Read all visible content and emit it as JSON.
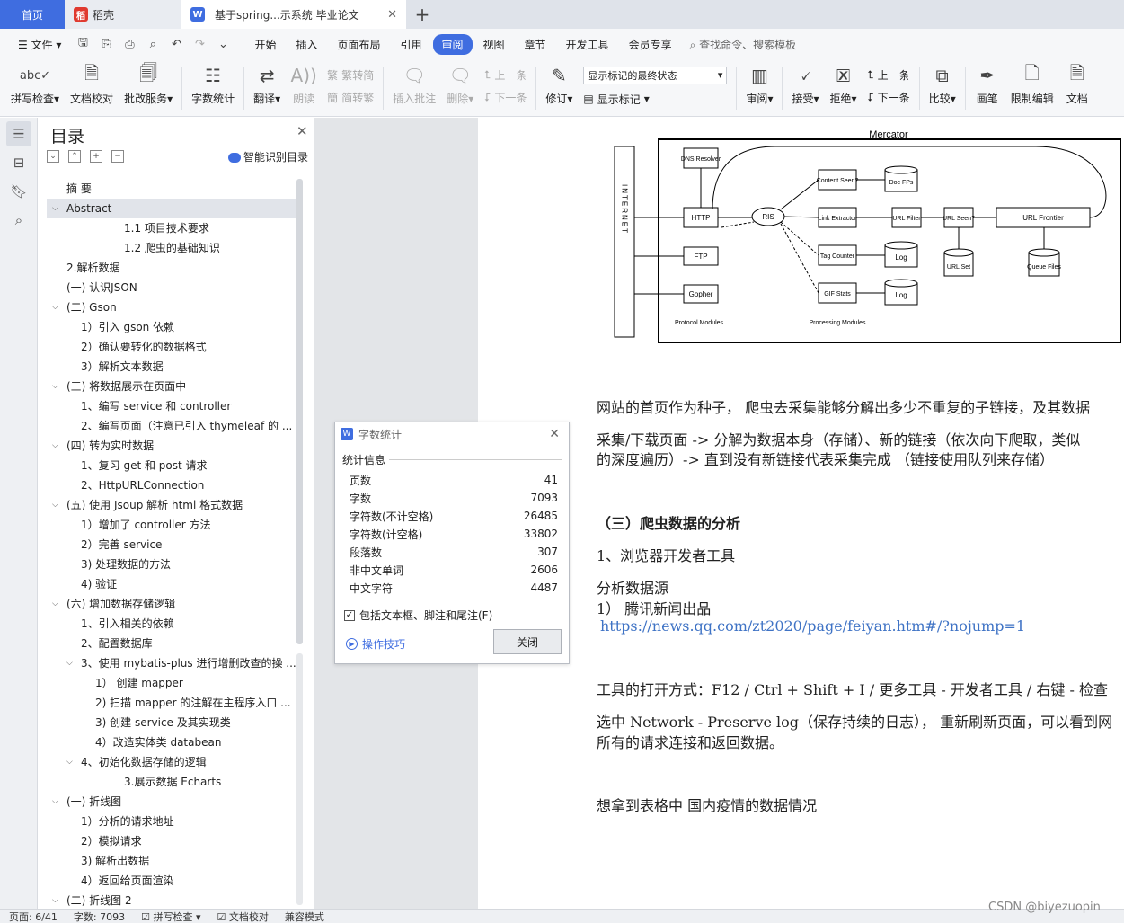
{
  "tabs": {
    "home": "首页",
    "daoke": "稻壳",
    "doc": "基于spring...示系统 毕业论文"
  },
  "menu": {
    "file": "文件",
    "items": [
      "开始",
      "插入",
      "页面布局",
      "引用",
      "审阅",
      "视图",
      "章节",
      "开发工具",
      "会员专享"
    ],
    "active_index": 4,
    "search": "查找命令、搜索模板"
  },
  "ribbon": {
    "spell": "拼写检查",
    "proof": "文档校对",
    "correct": "批改服务",
    "count": "字数统计",
    "translate": "翻译",
    "read": "朗读",
    "t2s": "繁转简",
    "s2t": "简转繁",
    "insert_comment": "插入批注",
    "delete": "删除",
    "prev": "上一条",
    "next": "下一条",
    "revise": "修订",
    "markup_select": "显示标记的最终状态",
    "show_markup": "显示标记",
    "review": "审阅",
    "accept": "接受",
    "reject": "拒绝",
    "prev2": "上一条",
    "next2": "下一条",
    "compare": "比较",
    "pen": "画笔",
    "restrict": "限制编辑",
    "doc": "文档"
  },
  "toc": {
    "title": "目录",
    "smart": "智能识别目录",
    "items": [
      {
        "text": "摘  要",
        "level": 1,
        "arrow": ""
      },
      {
        "text": "Abstract",
        "level": 1,
        "arrow": "v",
        "selected": true
      },
      {
        "text": "1.1 项目技术要求",
        "level": 4,
        "arrow": ""
      },
      {
        "text": "1.2 爬虫的基础知识",
        "level": 4,
        "arrow": ""
      },
      {
        "text": "2.解析数据",
        "level": 1,
        "arrow": ""
      },
      {
        "text": "(一) 认识JSON",
        "level": 1,
        "arrow": ""
      },
      {
        "text": "(二) Gson",
        "level": 1,
        "arrow": "v"
      },
      {
        "text": "1）引入 gson 依赖",
        "level": 2,
        "arrow": ""
      },
      {
        "text": "2）确认要转化的数据格式",
        "level": 2,
        "arrow": ""
      },
      {
        "text": "3）解析文本数据",
        "level": 2,
        "arrow": ""
      },
      {
        "text": "(三) 将数据展示在页面中",
        "level": 1,
        "arrow": "v"
      },
      {
        "text": "1、编写 service 和 controller",
        "level": 2,
        "arrow": ""
      },
      {
        "text": "2、编写页面（注意已引入 thymeleaf 的 ...",
        "level": 2,
        "arrow": ""
      },
      {
        "text": "(四) 转为实时数据",
        "level": 1,
        "arrow": "v"
      },
      {
        "text": "1、复习 get 和 post 请求",
        "level": 2,
        "arrow": ""
      },
      {
        "text": "2、HttpURLConnection",
        "level": 2,
        "arrow": ""
      },
      {
        "text": "(五) 使用 Jsoup 解析 html 格式数据",
        "level": 1,
        "arrow": "v"
      },
      {
        "text": "1）增加了 controller 方法",
        "level": 2,
        "arrow": ""
      },
      {
        "text": "2）完善 service",
        "level": 2,
        "arrow": ""
      },
      {
        "text": "3) 处理数据的方法",
        "level": 2,
        "arrow": ""
      },
      {
        "text": "4) 验证",
        "level": 2,
        "arrow": ""
      },
      {
        "text": "(六) 增加数据存储逻辑",
        "level": 1,
        "arrow": "v"
      },
      {
        "text": "1、引入相关的依赖",
        "level": 2,
        "arrow": ""
      },
      {
        "text": "2、配置数据库",
        "level": 2,
        "arrow": ""
      },
      {
        "text": "3、使用 mybatis-plus 进行增删改查的操 ...",
        "level": 2,
        "arrow": "v"
      },
      {
        "text": "1）  创建 mapper",
        "level": 3,
        "arrow": ""
      },
      {
        "text": "2) 扫描 mapper 的注解在主程序入口 ...",
        "level": 3,
        "arrow": ""
      },
      {
        "text": "3) 创建 service 及其实现类",
        "level": 3,
        "arrow": ""
      },
      {
        "text": "4）改造实体类 databean",
        "level": 3,
        "arrow": ""
      },
      {
        "text": "4、初始化数据存储的逻辑",
        "level": 2,
        "arrow": "v"
      },
      {
        "text": "3.展示数据 Echarts",
        "level": 4,
        "arrow": ""
      },
      {
        "text": "(一) 折线图",
        "level": 1,
        "arrow": "v"
      },
      {
        "text": "1）分析的请求地址",
        "level": 2,
        "arrow": ""
      },
      {
        "text": "2）模拟请求",
        "level": 2,
        "arrow": ""
      },
      {
        "text": "3) 解析出数据",
        "level": 2,
        "arrow": ""
      },
      {
        "text": "4）返回给页面渲染",
        "level": 2,
        "arrow": ""
      },
      {
        "text": "(二) 折线图 2",
        "level": 1,
        "arrow": "v"
      }
    ]
  },
  "dialog": {
    "title": "字数统计",
    "section": "统计信息",
    "rows": [
      {
        "label": "页数",
        "value": "41"
      },
      {
        "label": "字数",
        "value": "7093"
      },
      {
        "label": "字符数(不计空格)",
        "value": "26485"
      },
      {
        "label": "字符数(计空格)",
        "value": "33802"
      },
      {
        "label": "段落数",
        "value": "307"
      },
      {
        "label": "非中文单词",
        "value": "2606"
      },
      {
        "label": "中文字符",
        "value": "4487"
      }
    ],
    "checkbox": "包括文本框、脚注和尾注(F)",
    "tips": "操作技巧",
    "close": "关闭"
  },
  "figure": {
    "title": "Mercator",
    "internet": "INTERNET",
    "dns": "DNS Resolver",
    "http": "HTTP",
    "ftp": "FTP",
    "gopher": "Gopher",
    "ris": "RIS",
    "content": "Content Seen?",
    "docfps": "Doc FPs",
    "link": "Link Extractor",
    "urlfilter": "URL Filter",
    "urlseen": "URL Seen?",
    "frontier": "URL Frontier",
    "tag": "Tag Counter",
    "gif": "GIF Stats",
    "log": "Log",
    "urlset": "URL Set",
    "queue": "Queue Files",
    "protocol": "Protocol Modules",
    "processing": "Processing Modules"
  },
  "doc": {
    "p1": "网站的首页作为种子， 爬虫去采集能够分解出多少不重复的子链接，及其数据",
    "p2a": "采集/下载页面 -> 分解为数据本身（存储）、新的链接（依次向下爬取，类似",
    "p2b": "的深度遍历）-> 直到没有新链接代表采集完成 （链接使用队列来存储）",
    "h3": "（三）爬虫数据的分析",
    "l1": "1、浏览器开发者工具",
    "l2": "分析数据源",
    "l3": "1） 腾讯新闻出品",
    "link": "https://news.qq.com/zt2020/page/feiyan.htm#/?nojump=1",
    "l4": "工具的打开方式：F12 / Ctrl + Shift + I / 更多工具 - 开发者工具 / 右键 - 检查",
    "l5a": "选中 Network - Preserve log（保存持续的日志）， 重新刷新页面，可以看到网",
    "l5b": "所有的请求连接和返回数据。",
    "l6": "想拿到表格中 国内疫情的数据情况"
  },
  "status": {
    "page": "页面: 6/41",
    "words": "字数: 7093",
    "spell": "拼写检查",
    "proof": "文档校对",
    "compat": "兼容模式"
  },
  "watermark": "CSDN @biyezuopin"
}
